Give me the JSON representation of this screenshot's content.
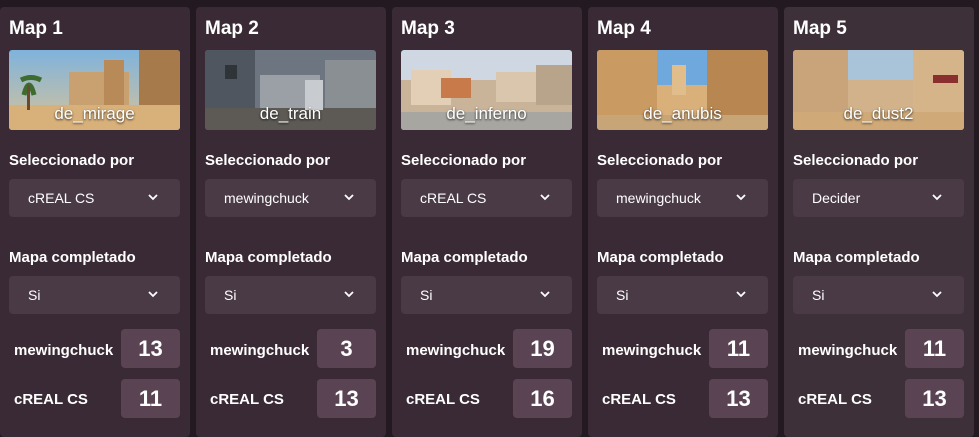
{
  "maps": [
    {
      "title": "Map 1",
      "code": "de_mirage",
      "selected_label": "Seleccionado por",
      "selected_value": "cREAL CS",
      "completed_label": "Mapa completado",
      "completed_value": "Si",
      "teams": [
        {
          "name": "mewingchuck",
          "score": "13"
        },
        {
          "name": "cREAL CS",
          "score": "11"
        }
      ]
    },
    {
      "title": "Map 2",
      "code": "de_train",
      "selected_label": "Seleccionado por",
      "selected_value": "mewingchuck",
      "completed_label": "Mapa completado",
      "completed_value": "Si",
      "teams": [
        {
          "name": "mewingchuck",
          "score": "3"
        },
        {
          "name": "cREAL CS",
          "score": "13"
        }
      ]
    },
    {
      "title": "Map 3",
      "code": "de_inferno",
      "selected_label": "Seleccionado por",
      "selected_value": "cREAL CS",
      "completed_label": "Mapa completado",
      "completed_value": "Si",
      "teams": [
        {
          "name": "mewingchuck",
          "score": "19"
        },
        {
          "name": "cREAL CS",
          "score": "16"
        }
      ]
    },
    {
      "title": "Map 4",
      "code": "de_anubis",
      "selected_label": "Seleccionado por",
      "selected_value": "mewingchuck",
      "completed_label": "Mapa completado",
      "completed_value": "Si",
      "teams": [
        {
          "name": "mewingchuck",
          "score": "11"
        },
        {
          "name": "cREAL CS",
          "score": "13"
        }
      ]
    },
    {
      "title": "Map 5",
      "code": "de_dust2",
      "selected_label": "Seleccionado por",
      "selected_value": "Decider",
      "completed_label": "Mapa completado",
      "completed_value": "Si",
      "teams": [
        {
          "name": "mewingchuck",
          "score": "11"
        },
        {
          "name": "cREAL CS",
          "score": "13"
        }
      ]
    }
  ],
  "colors": {
    "page_background": "#221a20",
    "card_background": "#3a2a35",
    "select_background": "#4a3a46",
    "score_background": "#5a4454"
  },
  "icons": {
    "dropdown": "chevron-down-icon"
  }
}
